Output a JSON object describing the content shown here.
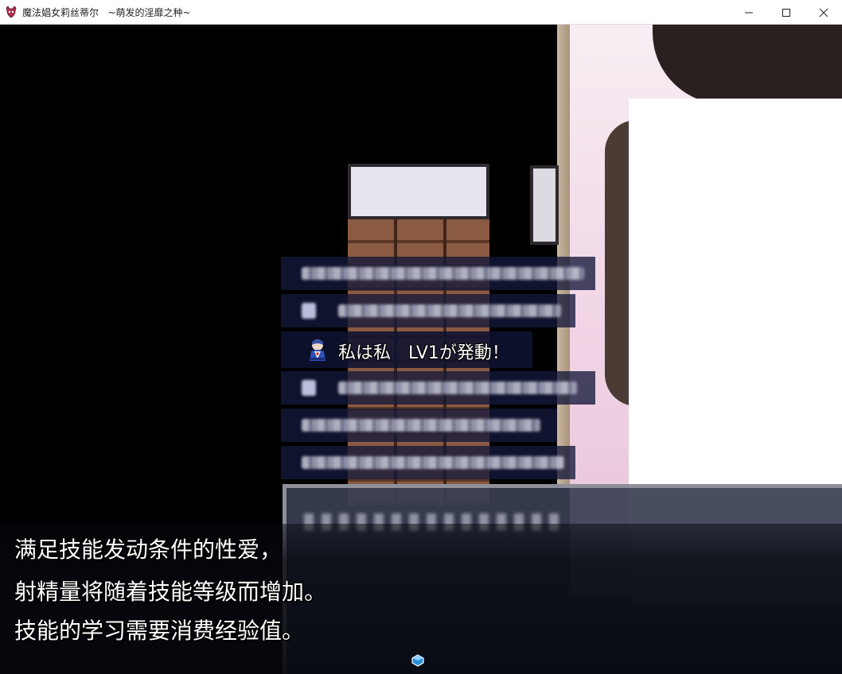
{
  "window": {
    "title": "魔法娼女莉丝蒂尔   ~萌发的淫靡之种~",
    "icon": "demon-heart-icon",
    "controls": [
      "minimize-icon",
      "maximize-icon",
      "close-icon"
    ]
  },
  "battle_log": {
    "rows": [
      {
        "obscured": true,
        "has_icon": false
      },
      {
        "obscured": true,
        "has_icon": true
      },
      {
        "obscured": false,
        "has_icon": true,
        "icon": "skill-character-icon",
        "text": "私は私　LV1が発動！"
      },
      {
        "obscured": true,
        "has_icon": true
      },
      {
        "obscured": true,
        "has_icon": false
      },
      {
        "obscured": true,
        "has_icon": false
      }
    ]
  },
  "message": {
    "lines": [
      "满足技能发动条件的性爱，",
      "射精量将随着技能等级而增加。",
      "技能的学习需要消费经验值。"
    ],
    "pause_indicator": "pause-cursor-icon"
  },
  "colors": {
    "log_bg": "#14183a",
    "text": "#ffffff",
    "titlebar_bg": "#ffffff",
    "scene_pink": "#f1d6e6",
    "drawer_brown": "#8b5a42"
  }
}
